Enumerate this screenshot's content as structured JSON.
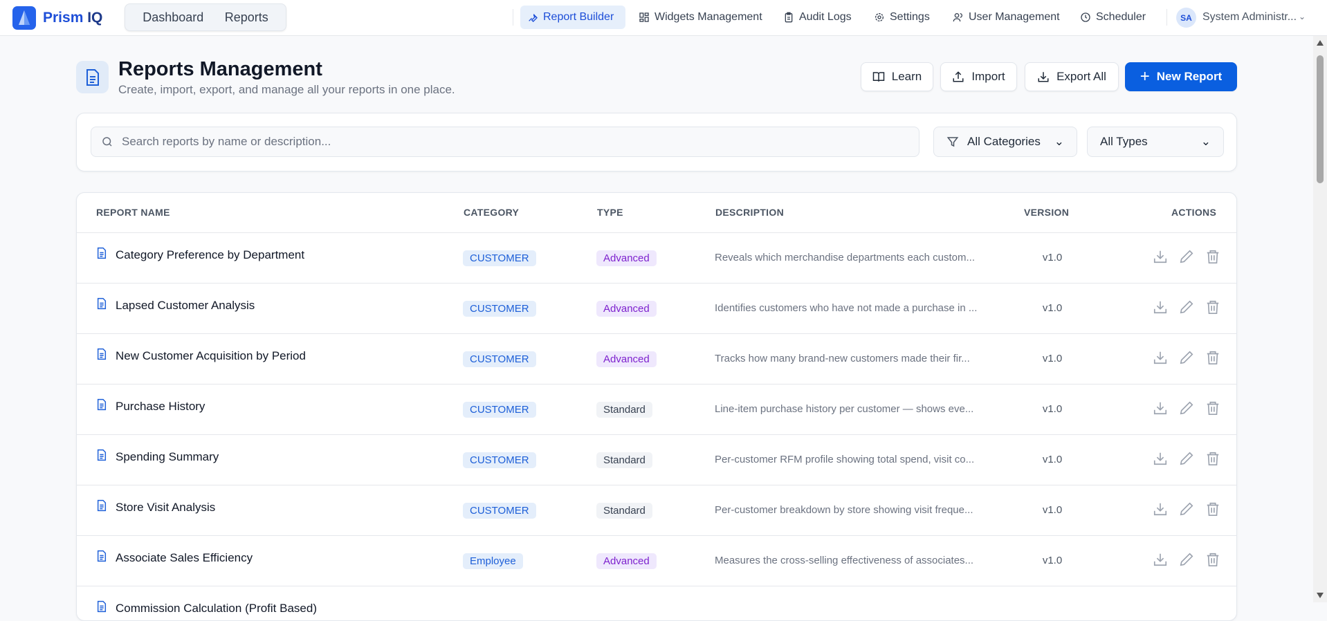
{
  "app": {
    "brand_a": "Prism",
    "brand_b": "IQ"
  },
  "topnav": {
    "pill": [
      "Dashboard",
      "Reports"
    ],
    "items": [
      {
        "label": "Report Builder",
        "icon": "wrench-icon",
        "active": true
      },
      {
        "label": "Widgets Management",
        "icon": "grid-icon"
      },
      {
        "label": "Audit Logs",
        "icon": "clipboard-icon"
      },
      {
        "label": "Settings",
        "icon": "gear-icon"
      },
      {
        "label": "User Management",
        "icon": "users-icon"
      },
      {
        "label": "Scheduler",
        "icon": "clock-icon"
      }
    ],
    "user": {
      "initials": "SA",
      "name": "System Administr..."
    }
  },
  "page": {
    "title": "Reports Management",
    "subtitle": "Create, import, export, and manage all your reports in one place.",
    "buttons": {
      "learn": "Learn",
      "import": "Import",
      "export": "Export All",
      "new": "New Report"
    }
  },
  "filters": {
    "search_placeholder": "Search reports by name or description...",
    "category": "All Categories",
    "type": "All Types"
  },
  "table": {
    "headers": [
      "REPORT NAME",
      "CATEGORY",
      "TYPE",
      "DESCRIPTION",
      "VERSION",
      "ACTIONS"
    ],
    "rows": [
      {
        "name": "Category Preference by Department",
        "category": "CUSTOMER",
        "type": "Advanced",
        "description": "Reveals which merchandise departments each custom...",
        "version": "v1.0"
      },
      {
        "name": "Lapsed Customer Analysis",
        "category": "CUSTOMER",
        "type": "Advanced",
        "description": "Identifies customers who have not made a purchase in ...",
        "version": "v1.0"
      },
      {
        "name": "New Customer Acquisition by Period",
        "category": "CUSTOMER",
        "type": "Advanced",
        "description": "Tracks how many brand-new customers made their fir...",
        "version": "v1.0"
      },
      {
        "name": "Purchase History",
        "category": "CUSTOMER",
        "type": "Standard",
        "description": "Line-item purchase history per customer — shows eve...",
        "version": "v1.0"
      },
      {
        "name": "Spending Summary",
        "category": "CUSTOMER",
        "type": "Standard",
        "description": "Per-customer RFM profile showing total spend, visit co...",
        "version": "v1.0"
      },
      {
        "name": "Store Visit Analysis",
        "category": "CUSTOMER",
        "type": "Standard",
        "description": "Per-customer breakdown by store showing visit freque...",
        "version": "v1.0"
      },
      {
        "name": "Associate Sales Efficiency",
        "category": "Employee",
        "type": "Advanced",
        "description": "Measures the cross-selling effectiveness of associates...",
        "version": "v1.0"
      },
      {
        "name": "Commission Calculation (Profit Based)",
        "category": "",
        "type": "",
        "description": "",
        "version": ""
      }
    ]
  }
}
